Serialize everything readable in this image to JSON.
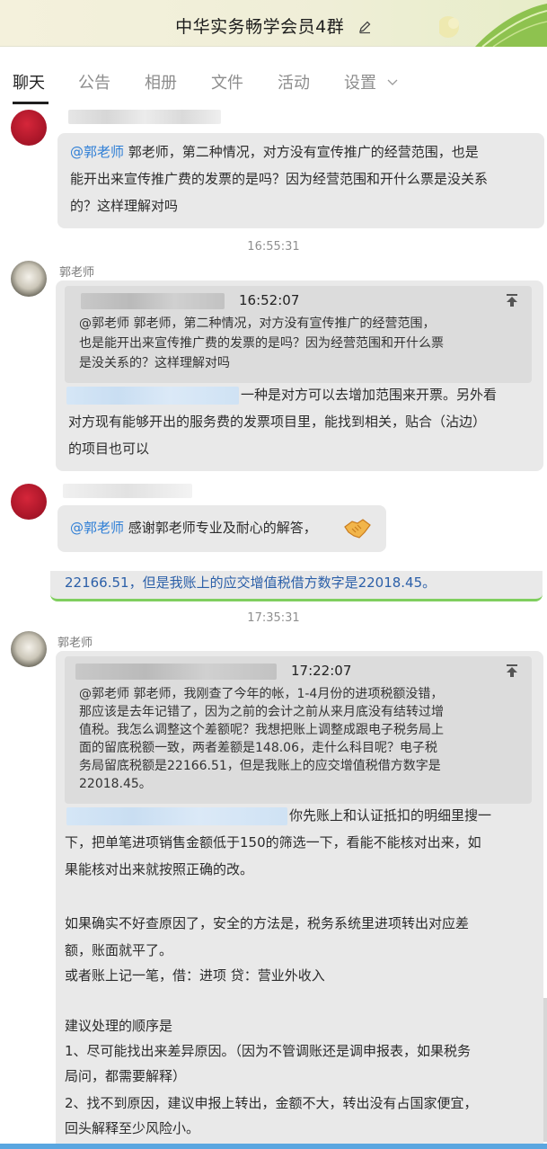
{
  "header": {
    "title": "中华实务畅学会员4群",
    "edit_icon": "pencil-icon"
  },
  "tabs": [
    {
      "label": "聊天",
      "active": true
    },
    {
      "label": "公告"
    },
    {
      "label": "相册"
    },
    {
      "label": "文件"
    },
    {
      "label": "活动"
    },
    {
      "label": "设置"
    }
  ],
  "messages": {
    "m1": {
      "mention": "@郭老师",
      "lines": [
        "郭老师，第二种情况，对方没有宣传推广的经营范围，也是",
        "能开出来宣传推广费的发票的是吗？因为经营范围和开什么票是没关系",
        "的？这样理解对吗"
      ]
    },
    "t1": "16:55:31",
    "m2": {
      "sender": "郭老师",
      "quote_time": "16:52:07",
      "quote_lines": [
        "@郭老师 郭老师，第二种情况，对方没有宣传推广的经营范围，",
        "也是能开出来宣传推广费的发票的是吗？因为经营范围和开什么票",
        "是没关系的？这样理解对吗"
      ],
      "lines": [
        "一种是对方可以去增加范围来开票。另外看",
        "对方现有能够开出的服务费的发票项目里，能找到相关，贴合（沾边）",
        "的项目也可以"
      ]
    },
    "m3": {
      "mention": "@郭老师",
      "text": "感谢郭老师专业及耐心的解答，",
      "emoji": "handshake-icon"
    },
    "strip_text": "22166.51，但是我账上的应交增值税借方数字是22018.45。",
    "t2": "17:35:31",
    "m4": {
      "sender": "郭老师",
      "quote_time": "17:22:07",
      "quote_lines": [
        "@郭老师 郭老师，我刚查了今年的帐，1-4月份的进项税额没错，",
        "那应该是去年记错了，因为之前的会计之前从来月底没有结转过增",
        "值税。我怎么调整这个差额呢？我想把账上调整成跟电子税务局上",
        "面的留底税额一致，两者差额是148.06，走什么科目呢？电子税",
        "务局留底税额是22166.51，但是我账上的应交增值税借方数字是",
        "22018.45。"
      ],
      "lines": [
        "你先账上和认证抵扣的明细里搜一",
        "下，把单笔进项销售金额低于150的筛选一下，看能不能核对出来，如",
        "果能核对出来就按照正确的改。",
        "",
        "如果确实不好查原因了，安全的方法是，税务系统里进项转出对应差",
        "额，账面就平了。",
        "或者账上记一笔，借：进项  贷：营业外收入",
        "",
        "建议处理的顺序是",
        "1、尽可能找出来差异原因。（因为不管调账还是调申报表，如果税务",
        "局问，都需要解释）",
        "2、找不到原因，建议申报上转出，金额不大，转出没有占国家便宜，",
        "回头解释至少风险小。"
      ]
    }
  },
  "icons": {
    "pin_up": "arrow-up-icon",
    "chevron": "chevron-down-icon"
  },
  "colors": {
    "mention": "#2f7fd6",
    "bubble": "#e9e9e9",
    "quote": "#dcdcdc",
    "title_bg": "#f4f1dc"
  }
}
